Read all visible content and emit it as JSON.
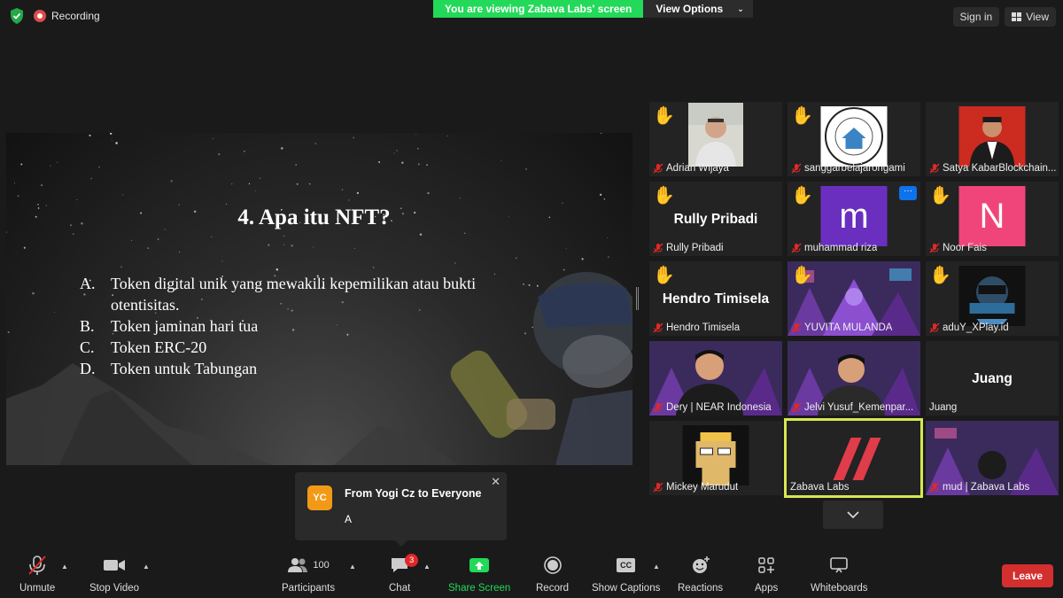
{
  "top": {
    "recording_label": "Recording",
    "viewing_label": "You are viewing Zabava Labs' screen",
    "view_options_label": "View Options",
    "sign_in_label": "Sign in",
    "view_label": "View"
  },
  "slide": {
    "title": "4. Apa itu NFT?",
    "options": [
      {
        "letter": "A.",
        "text": "Token digital unik yang mewakili kepemilikan atau bukti otentisitas."
      },
      {
        "letter": "B.",
        "text": "Token jaminan hari tua"
      },
      {
        "letter": "C.",
        "text": "Token ERC-20"
      },
      {
        "letter": "D.",
        "text": "Token untuk Tabungan"
      }
    ]
  },
  "participants": [
    {
      "name": "Adrian Wijaya",
      "raised_hand": true
    },
    {
      "name": "sanggarbelajarorigami",
      "raised_hand": true
    },
    {
      "name": "Satya KabarBlockchain...",
      "raised_hand": false
    },
    {
      "name": "Rully Pribadi",
      "raised_hand": true,
      "display": "Rully Pribadi"
    },
    {
      "name": "muhammad riza",
      "raised_hand": true,
      "avatar_letter": "m",
      "avatar_color": "#6b2fc0"
    },
    {
      "name": "Noor Fais",
      "raised_hand": true,
      "avatar_letter": "N",
      "avatar_color": "#f0457a"
    },
    {
      "name": "Hendro Timisela",
      "raised_hand": true,
      "display": "Hendro Timisela"
    },
    {
      "name": "YUVITA MULANDA",
      "raised_hand": true
    },
    {
      "name": "aduY_XPlay.id",
      "raised_hand": true
    },
    {
      "name": "Dery | NEAR Indonesia",
      "raised_hand": false
    },
    {
      "name": "Jelvi Yusuf_Kemenpar...",
      "raised_hand": false
    },
    {
      "name": "Juang",
      "raised_hand": false,
      "display": "Juang"
    },
    {
      "name": "Mickey Marudut",
      "raised_hand": false
    },
    {
      "name": "Zabava Labs",
      "raised_hand": false
    },
    {
      "name": "mud | Zabava Labs",
      "raised_hand": false
    }
  ],
  "chat_toast": {
    "avatar_initials": "YC",
    "from": "From Yogi Cz to Everyone",
    "message": "A"
  },
  "toolbar": {
    "unmute": "Unmute",
    "stop_video": "Stop Video",
    "participants": "Participants",
    "participants_count": "100",
    "chat": "Chat",
    "chat_badge": "3",
    "share_screen": "Share Screen",
    "record": "Record",
    "show_captions": "Show Captions",
    "cc": "CC",
    "reactions": "Reactions",
    "apps": "Apps",
    "whiteboards": "Whiteboards",
    "leave": "Leave"
  },
  "colors": {
    "accent_green": "#23d959",
    "leave_red": "#d42f2f",
    "active_speaker": "#d7e84f"
  }
}
